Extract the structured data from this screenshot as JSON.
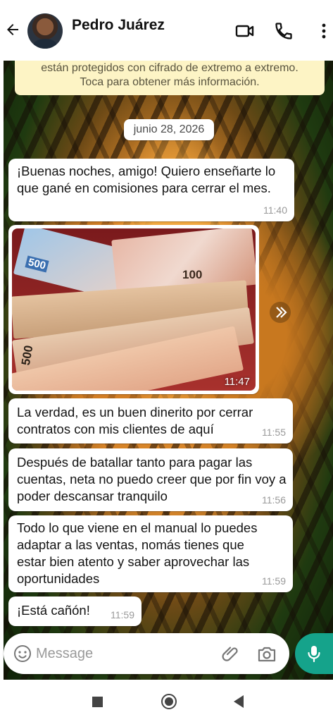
{
  "header": {
    "contact_name": "Pedro Juárez",
    "icons": [
      "back-arrow-icon",
      "video-call-icon",
      "phone-icon",
      "more-vert-icon"
    ]
  },
  "chat": {
    "encryption_line1": "están protegidos con cifrado de extremo a extremo.",
    "encryption_line2": "Toca para obtener más información.",
    "date_chip": "junio 28, 2026",
    "messages": [
      {
        "text": "¡Buenas noches, amigo! Quiero enseñarte lo que gané en comisiones para cerrar el mes.",
        "time": "11:40"
      },
      {
        "type": "image",
        "description_labels": [
          "500",
          "100",
          "500"
        ],
        "time": "11:47"
      },
      {
        "text": "La verdad, es un buen dinerito por cerrar contratos con mis clientes de aquí",
        "time": "11:55"
      },
      {
        "text": "Después de batallar tanto para pagar las cuentas, neta no puedo creer que por fin voy a poder descansar tranquilo",
        "time": "11:56"
      },
      {
        "text": "Todo lo que viene en el manual lo puedes adaptar a las ventas, nomás tienes que estar bien atento y saber aprovechar las oportunidades",
        "time": "11:59"
      },
      {
        "text": "¡Está cañón!",
        "time": "11:59"
      }
    ]
  },
  "composer": {
    "placeholder": "Message",
    "icons": [
      "emoji-icon",
      "attach-icon",
      "camera-icon",
      "mic-icon"
    ]
  },
  "colors": {
    "accent": "#15a38b",
    "encryption_bg": "#fdf4c5",
    "bubble_bg": "#ffffff"
  }
}
